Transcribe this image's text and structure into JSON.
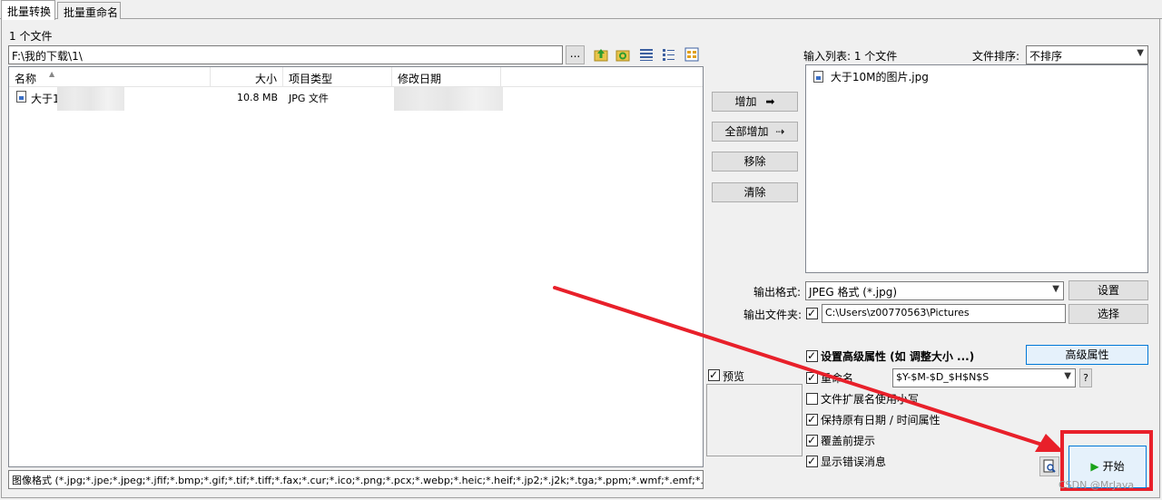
{
  "tabs": [
    "批量转换",
    "批量重命名"
  ],
  "file_count_label": "1 个文件",
  "path_value": "F:\\我的下载\\1\\",
  "browse_label": "...",
  "toolbar_icons": [
    "folder-up-icon",
    "refresh-icon",
    "details-view-icon",
    "list-view-icon",
    "thumbnail-view-icon"
  ],
  "file_table": {
    "columns": [
      "名称",
      "大小",
      "项目类型",
      "修改日期"
    ],
    "rows": [
      {
        "name": "大于1",
        "size": "10.8 MB",
        "type": "JPG 文件",
        "date": ""
      }
    ]
  },
  "filter_text": "图像格式 (*.jpg;*.jpe;*.jpeg;*.jfif;*.bmp;*.gif;*.tif;*.tiff;*.fax;*.cur;*.ico;*.png;*.pcx;*.webp;*.heic;*.heif;*.jp2;*.j2k;*.tga;*.ppm;*.wmf;*.emf;*.p",
  "buttons": {
    "add": "增加",
    "add_all": "全部增加",
    "remove": "移除",
    "clear": "清除",
    "settings": "设置",
    "select": "选择",
    "advanced": "高级属性",
    "help": "?",
    "start": "开始"
  },
  "input_list_label": "输入列表: 1 个文件",
  "sort_label": "文件排序:",
  "sort_value": "不排序",
  "input_list": [
    "大于10M的图片.jpg"
  ],
  "output_format_label": "输出格式:",
  "output_format_value": "JPEG 格式 (*.jpg)",
  "output_folder_label": "输出文件夹:",
  "output_folder_value": "C:\\Users\\z00770563\\Pictures",
  "preview_label": "预览",
  "options": {
    "advanced_label": "设置高级属性 (如 调整大小 ...)",
    "rename_label": "重命名",
    "rename_pattern": "$Y-$M-$D_$H$N$S",
    "lowercase_ext_label": "文件扩展名使用小写",
    "keep_date_label": "保持原有日期 / 时间属性",
    "overwrite_prompt_label": "覆盖前提示",
    "show_errors_label": "显示错误消息"
  },
  "watermark": "CSDN @MrJava",
  "colors": {
    "highlight_red": "#e8202a",
    "play_green": "#1aa31a",
    "advanced_button_border": "#0078d7"
  }
}
